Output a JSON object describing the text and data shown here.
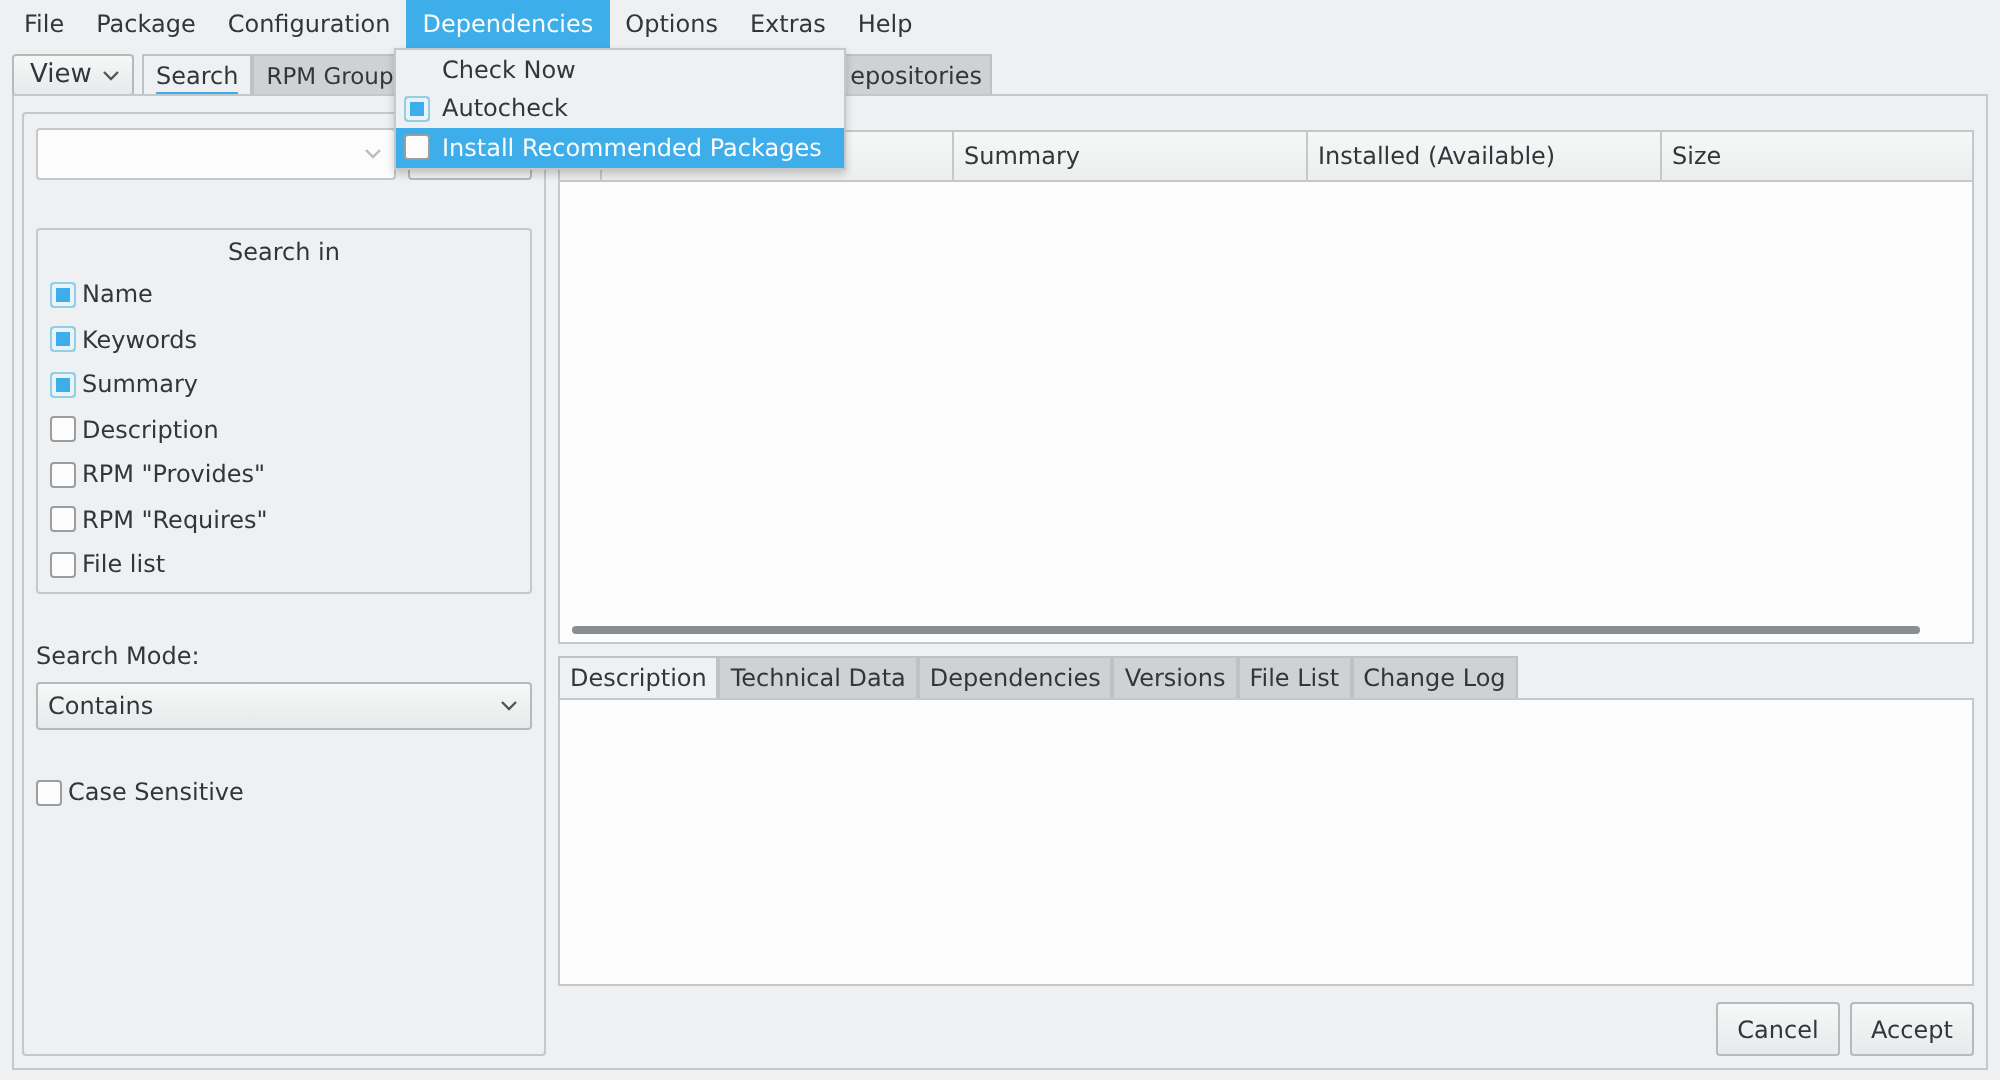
{
  "menubar": [
    {
      "label": "File",
      "selected": false
    },
    {
      "label": "Package",
      "selected": false
    },
    {
      "label": "Configuration",
      "selected": false
    },
    {
      "label": "Dependencies",
      "selected": true
    },
    {
      "label": "Options",
      "selected": false
    },
    {
      "label": "Extras",
      "selected": false
    },
    {
      "label": "Help",
      "selected": false
    }
  ],
  "menu": {
    "items": [
      {
        "label": "Check Now",
        "kind": "action",
        "highlighted": false
      },
      {
        "label": "Autocheck",
        "kind": "check",
        "checked": true,
        "highlighted": false
      },
      {
        "label": "Install Recommended Packages",
        "kind": "check",
        "checked": false,
        "highlighted": true
      }
    ]
  },
  "view_button": {
    "label": "View"
  },
  "tabs": [
    {
      "label": "Search",
      "selected": true
    },
    {
      "label": "RPM Group",
      "selected": false
    },
    {
      "label": "epositories",
      "selected": false
    }
  ],
  "search_panel": {
    "search_in": {
      "title": "Search in",
      "options": [
        {
          "label": "Name",
          "checked": true
        },
        {
          "label": "Keywords",
          "checked": true
        },
        {
          "label": "Summary",
          "checked": true
        },
        {
          "label": "Description",
          "checked": false
        },
        {
          "label": "RPM \"Provides\"",
          "checked": false
        },
        {
          "label": "RPM \"Requires\"",
          "checked": false
        },
        {
          "label": "File list",
          "checked": false
        }
      ]
    },
    "search_mode": {
      "label": "Search Mode:",
      "value": "Contains"
    },
    "case_sensitive": {
      "label": "Case Sensitive",
      "checked": false
    }
  },
  "package_table": {
    "columns": [
      "Summary",
      "Installed (Available)",
      "Size"
    ]
  },
  "detail_tabs": [
    {
      "label": "Description",
      "selected": true
    },
    {
      "label": "Technical Data",
      "selected": false
    },
    {
      "label": "Dependencies",
      "selected": false
    },
    {
      "label": "Versions",
      "selected": false
    },
    {
      "label": "File List",
      "selected": false
    },
    {
      "label": "Change Log",
      "selected": false
    }
  ],
  "buttons": [
    "Cancel",
    "Accept"
  ]
}
